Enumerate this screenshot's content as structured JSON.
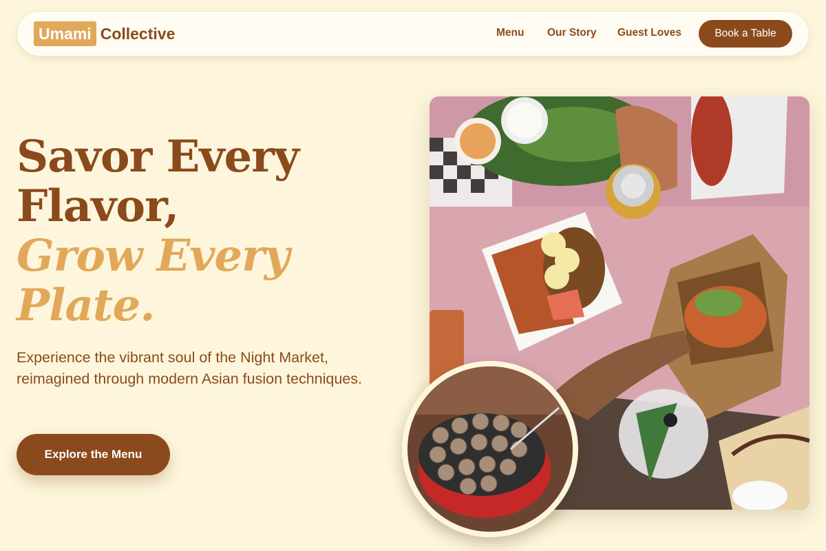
{
  "brand": {
    "badge": "Umami",
    "name": "Collective"
  },
  "nav": {
    "links": [
      "Menu",
      "Our Story",
      "Guest Loves"
    ],
    "cta": "Book a Table"
  },
  "hero": {
    "headline_line1": "Savor Every",
    "headline_line2": "Flavor,",
    "accent_line1": "Grow Every",
    "accent_line2": "Plate.",
    "description": "Experience the vibrant soul of the Night Market, reimagined through modern Asian fusion techniques.",
    "cta": "Explore the Menu"
  },
  "images": {
    "main": "night-market-food-spread-photo",
    "circle": "takoyaki-pan-photo"
  },
  "colors": {
    "background": "#fdf6dc",
    "primary": "#8b4a1b",
    "accent": "#e2a85a"
  }
}
